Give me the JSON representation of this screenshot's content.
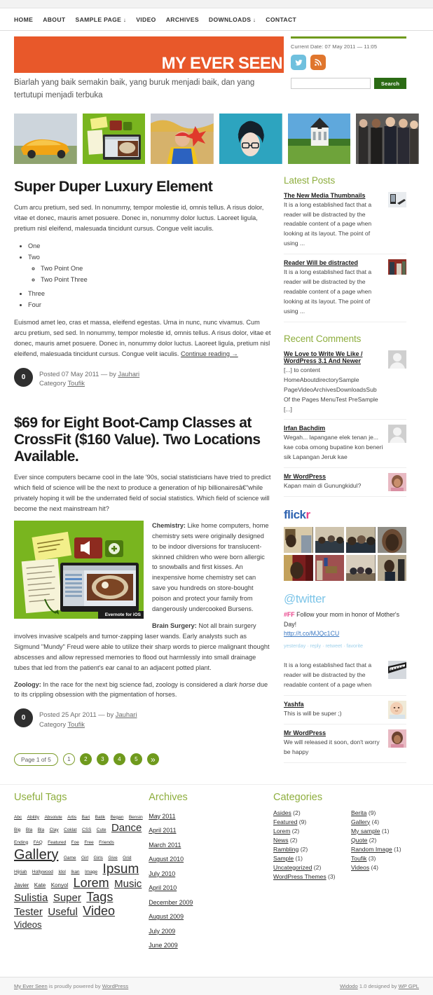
{
  "nav": {
    "items": [
      {
        "label": "HOME",
        "arrow": ""
      },
      {
        "label": "ABOUT",
        "arrow": ""
      },
      {
        "label": "SAMPLE PAGE",
        "arrow": "↓"
      },
      {
        "label": "VIDEO",
        "arrow": ""
      },
      {
        "label": "ARCHIVES",
        "arrow": ""
      },
      {
        "label": "DOWNLOADS",
        "arrow": "↓"
      },
      {
        "label": "CONTACT",
        "arrow": ""
      }
    ]
  },
  "header": {
    "logo": "MY EVER SEEN",
    "tagline": "Biarlah yang baik semakin baik, yang buruk menjadi baik, dan yang tertutupi menjadi terbuka",
    "current_date": "Current Date: 07 May 2011 — 11:05",
    "twitter_icon": "twitter-icon",
    "rss_icon": "rss-icon",
    "search_value": "",
    "search_placeholder": "",
    "search_button": "Search",
    "accent_orange": "#e8582a",
    "accent_green": "#6f9a1d"
  },
  "thumbstrip": [
    {
      "name": "thumb-sportscar"
    },
    {
      "name": "thumb-evernote"
    },
    {
      "name": "thumb-carnival"
    },
    {
      "name": "thumb-avatar"
    },
    {
      "name": "thumb-building"
    },
    {
      "name": "thumb-suits"
    }
  ],
  "posts": [
    {
      "title": "Super Duper Luxury Element",
      "intro": "Cum arcu pretium, sed sed. In nonummy, tempor molestie id, omnis tellus. A risus dolor, vitae et donec, mauris amet posuere. Donec in, nonummy dolor luctus. Laoreet ligula, pretium nisl eleifend, malesuada tincidunt cursus. Congue velit iaculis.",
      "list": [
        {
          "label": "One",
          "children": []
        },
        {
          "label": "Two",
          "children": [
            "Two Point One",
            "Two Point Three"
          ]
        },
        {
          "label": "Three",
          "children": []
        },
        {
          "label": "Four",
          "children": []
        }
      ],
      "body": "Euismod amet leo, cras et massa, eleifend egestas. Urna in nunc, nunc vivamus. Cum arcu pretium, sed sed. In nonummy, tempor molestie id, omnis tellus. A risus dolor, vitae et donec, mauris amet posuere. Donec in, nonummy dolor luctus. Laoreet ligula, pretium nisl eleifend, malesuada tincidunt cursus. Congue velit iaculis. ",
      "more": "Continue reading →",
      "comments": "0",
      "posted": "Posted 07 May 2011 — by ",
      "author": "Jauhari",
      "category_label": "Category ",
      "category": "Toufik"
    },
    {
      "title": "$69 for Eight Boot-Camp Classes at CrossFit ($160 Value). Two Locations Available.",
      "intro": "Ever since computers became cool in the late '90s, social statisticians have tried to predict which field of science will be the next to produce a generation of hip billionairesâ€\"while privately hoping it will be the underrated field of social statistics. Which field of science will become the next mainstream hit?",
      "figure_caption": "Evernote for iOS",
      "para_chem_lead": "Chemistry:",
      "para_chem": " Like home computers, home chemistry sets were originally designed to be indoor diversions for translucent-skinned children who were born allergic to snowballs and first kisses. An inexpensive home chemistry set can save you hundreds on store-bought poison and protect your family from dangerously undercooked Bursens.",
      "para_brain_lead": "Brain Surgery:",
      "para_brain": " Not all brain surgery involves invasive scalpels and tumor-zapping laser wands. Early analysts such as Sigmund \"Mundy\" Freud were able to utilize their sharp words to pierce malignant thought abscesses and allow repressed memories to flood out harmlessly into small drainage tubes that led from the patient's ear canal to an adjacent potted plant.",
      "para_zoo_lead": "Zoology:",
      "para_zoo_a": " In the race for the next big science fad, zoology is considered a ",
      "para_zoo_em": "dark horse",
      "para_zoo_b": " due to its crippling obsession with the pigmentation of horses.",
      "comments": "0",
      "posted": "Posted 25 Apr 2011 — by ",
      "author": "Jauhari",
      "category_label": "Category ",
      "category": "Toufik"
    }
  ],
  "pagination": {
    "label": "Page 1 of 5",
    "pages": [
      "1",
      "2",
      "3",
      "4",
      "5"
    ],
    "next": "»",
    "current": "1"
  },
  "sidebar": {
    "latest_posts": {
      "title": "Latest Posts",
      "items": [
        {
          "title": "The New Media Thumbnails",
          "excerpt": "It is a long established fact that a reader will be distracted by the readable content of a page when looking at its layout. The point of using ...",
          "thumb": "thumb-laptop"
        },
        {
          "title": "Reader Will be distracted",
          "excerpt": "It is a long established fact that a reader will be distracted by the readable content of a page when looking at its layout. The point of using ...",
          "thumb": "thumb-redwall"
        }
      ]
    },
    "recent_comments": {
      "title": "Recent Comments",
      "items": [
        {
          "author": "We Love to Write We Like / WordPress 3.1 And Newer",
          "text": "[...] to content HomeAboutdirectorySample PageVideoArchivesDownloadsSub Of the Pages MenuTest PreSample [...]",
          "avatar": "avatar-placeholder"
        },
        {
          "author": "Irfan Bachdim",
          "text": "Wegah... lapangane elek tenan je... kae coba omong bupatine kon beneri sik Lapangan Jeruk kae",
          "avatar": "avatar-placeholder"
        },
        {
          "author": "Mr WordPress",
          "text": "Kapan main di Gunungkidul?",
          "avatar": "avatar-photo"
        }
      ]
    },
    "flickr": {
      "title_a": "flick",
      "title_b": "r",
      "photos": [
        "flickr-1",
        "flickr-2",
        "flickr-3",
        "flickr-4",
        "flickr-5",
        "flickr-6",
        "flickr-7",
        "flickr-8"
      ]
    },
    "twitter": {
      "title": "@twitter",
      "hashtag": "#FF",
      "text": " Follow your mom in honor of Mother's Day!",
      "link": "http://t.co/MJQc1CU",
      "actions": "yesterday · reply · retweet · favorite"
    },
    "more_comments": [
      {
        "author": "",
        "text": "It is a long established fact that a reader will be distracted by the readable content of a page when",
        "avatar": "thumb-piano"
      },
      {
        "author": "Yashfa",
        "text": "This is will be super ;)",
        "avatar": "avatar-baby"
      },
      {
        "author": "Mr WordPress",
        "text": "We will released it soon, don't worry be happy",
        "avatar": "avatar-photo"
      }
    ]
  },
  "footer_widgets": {
    "tags": {
      "title": "Useful Tags",
      "items": [
        {
          "label": "Abc",
          "size": 6.5
        },
        {
          "label": "Ability",
          "size": 6.5
        },
        {
          "label": "Absolute",
          "size": 6.5
        },
        {
          "label": "Artis",
          "size": 6.5
        },
        {
          "label": "Bari",
          "size": 6.5
        },
        {
          "label": "Batik",
          "size": 6.5
        },
        {
          "label": "Began",
          "size": 6.5
        },
        {
          "label": "Bensin",
          "size": 6.5
        },
        {
          "label": "Big",
          "size": 6.5
        },
        {
          "label": "Bla",
          "size": 6.5
        },
        {
          "label": "Bla",
          "size": 6.5
        },
        {
          "label": "Clay",
          "size": 6.5
        },
        {
          "label": "Coklat",
          "size": 6.5
        },
        {
          "label": "CSS",
          "size": 6.5
        },
        {
          "label": "Cute",
          "size": 6.5
        },
        {
          "label": "Dance",
          "size": 15
        },
        {
          "label": "Ending",
          "size": 6.5
        },
        {
          "label": "FAQ",
          "size": 6.5
        },
        {
          "label": "Featured",
          "size": 6.5
        },
        {
          "label": "Foe",
          "size": 6.5
        },
        {
          "label": "Free",
          "size": 6.5
        },
        {
          "label": "Friends",
          "size": 6.5
        },
        {
          "label": "Gallery",
          "size": 20
        },
        {
          "label": "Game",
          "size": 6.5
        },
        {
          "label": "Girl",
          "size": 6.5
        },
        {
          "label": "Girls",
          "size": 6.5
        },
        {
          "label": "Give",
          "size": 6.5
        },
        {
          "label": "Grid",
          "size": 6.5
        },
        {
          "label": "Hijriah",
          "size": 6.5
        },
        {
          "label": "Hollywood",
          "size": 6.5
        },
        {
          "label": "Idol",
          "size": 6.5
        },
        {
          "label": "Ikan",
          "size": 6.5
        },
        {
          "label": "Image",
          "size": 6.5
        },
        {
          "label": "Ipsum",
          "size": 19
        },
        {
          "label": "Javier",
          "size": 8
        },
        {
          "label": "Kate",
          "size": 8
        },
        {
          "label": "Konyol",
          "size": 8
        },
        {
          "label": "Lorem",
          "size": 18
        },
        {
          "label": "Music",
          "size": 15
        },
        {
          "label": "Sulistia",
          "size": 15
        },
        {
          "label": "Super",
          "size": 15
        },
        {
          "label": "Tags",
          "size": 18
        },
        {
          "label": "Tester",
          "size": 15
        },
        {
          "label": "Useful",
          "size": 15
        },
        {
          "label": "Video",
          "size": 18
        },
        {
          "label": "Videos",
          "size": 13
        }
      ]
    },
    "archives": {
      "title": "Archives",
      "items": [
        "May 2011",
        "April 2011",
        "March 2011",
        "August 2010",
        "July 2010",
        "April 2010",
        "December 2009",
        "August 2009",
        "July 2009",
        "June 2009"
      ]
    },
    "categories": {
      "title": "Categories",
      "col1": [
        {
          "label": "Asides",
          "count": "(2)"
        },
        {
          "label": "Featured",
          "count": "(9)"
        },
        {
          "label": "Lorem",
          "count": "(2)"
        },
        {
          "label": "News",
          "count": "(2)"
        },
        {
          "label": "Rambling",
          "count": "(2)"
        },
        {
          "label": "Sample",
          "count": "(1)"
        },
        {
          "label": "Uncategorized",
          "count": "(2)"
        },
        {
          "label": "WordPress Themes",
          "count": "(3)"
        }
      ],
      "col2": [
        {
          "label": "Berita",
          "count": "(9)"
        },
        {
          "label": "Gallery",
          "count": "(4)"
        },
        {
          "label": "My sample",
          "count": "(1)"
        },
        {
          "label": "Quote",
          "count": "(2)"
        },
        {
          "label": "Random Image",
          "count": "(1)"
        },
        {
          "label": "Toufik",
          "count": "(3)"
        },
        {
          "label": "Videos",
          "count": "(4)"
        }
      ]
    }
  },
  "footer": {
    "left_site": "My Ever Seen",
    "left_text": " is proudly powered by ",
    "left_link": "WordPress",
    "right_theme": "Widodo",
    "right_text": " 1.0 designed by ",
    "right_link": "WP GPL"
  }
}
